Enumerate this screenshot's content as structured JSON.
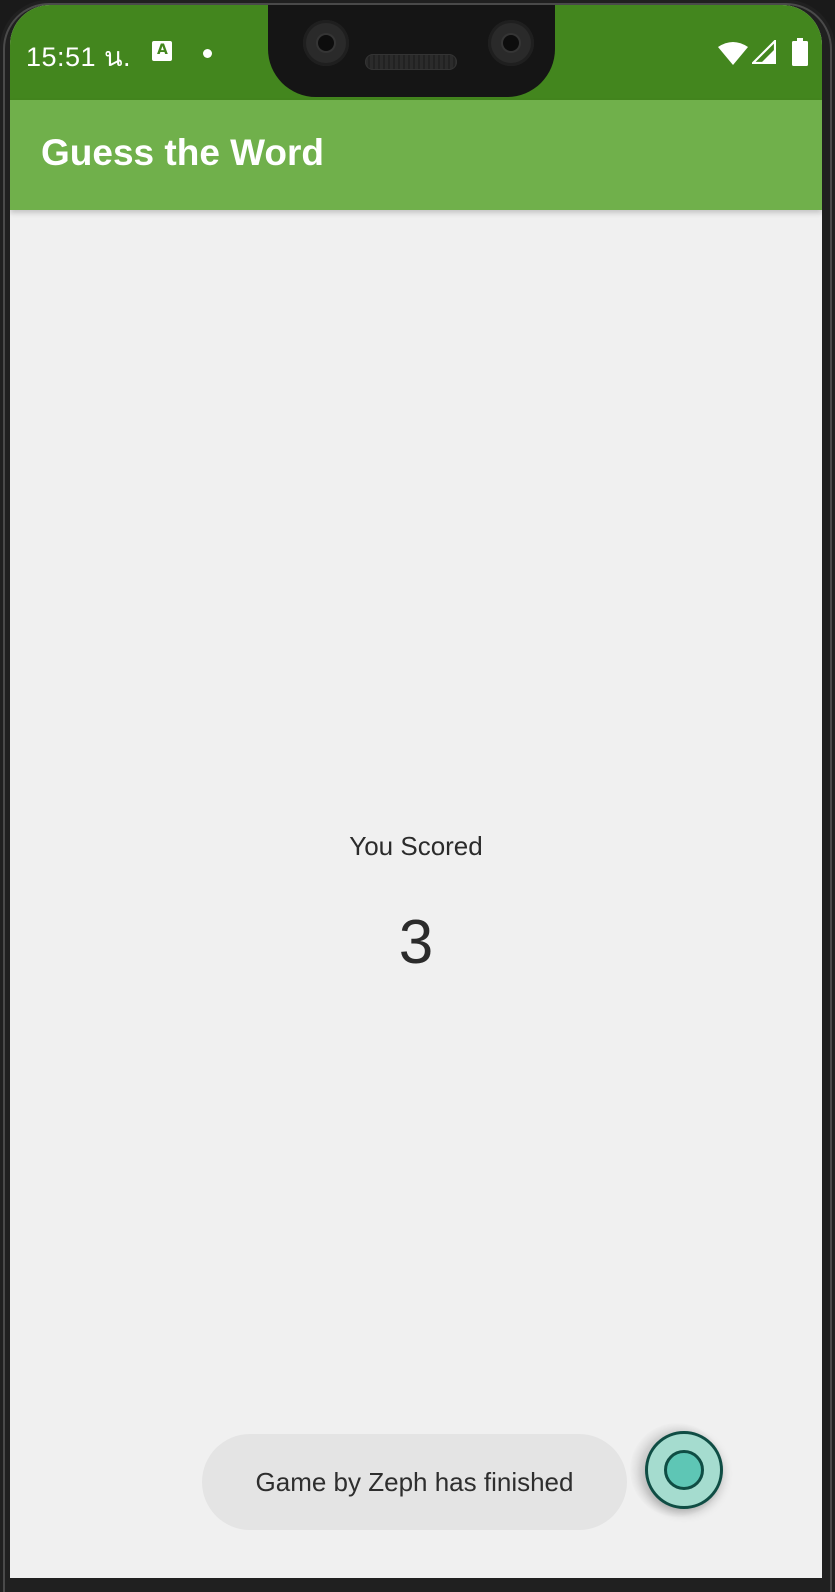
{
  "status_bar": {
    "time": "15:51 น.",
    "notification_icons": [
      "translate-icon",
      "dot-icon"
    ],
    "system_icons": [
      "wifi-icon",
      "signal-icon",
      "battery-icon"
    ],
    "color": "#43861e"
  },
  "app_bar": {
    "title": "Guess the Word",
    "color": "#70b04b"
  },
  "score": {
    "label": "You Scored",
    "value": "3"
  },
  "toast": {
    "message": "Game by Zeph has finished"
  },
  "fab": {
    "icon": "record-icon",
    "color": "#a5dccf"
  }
}
